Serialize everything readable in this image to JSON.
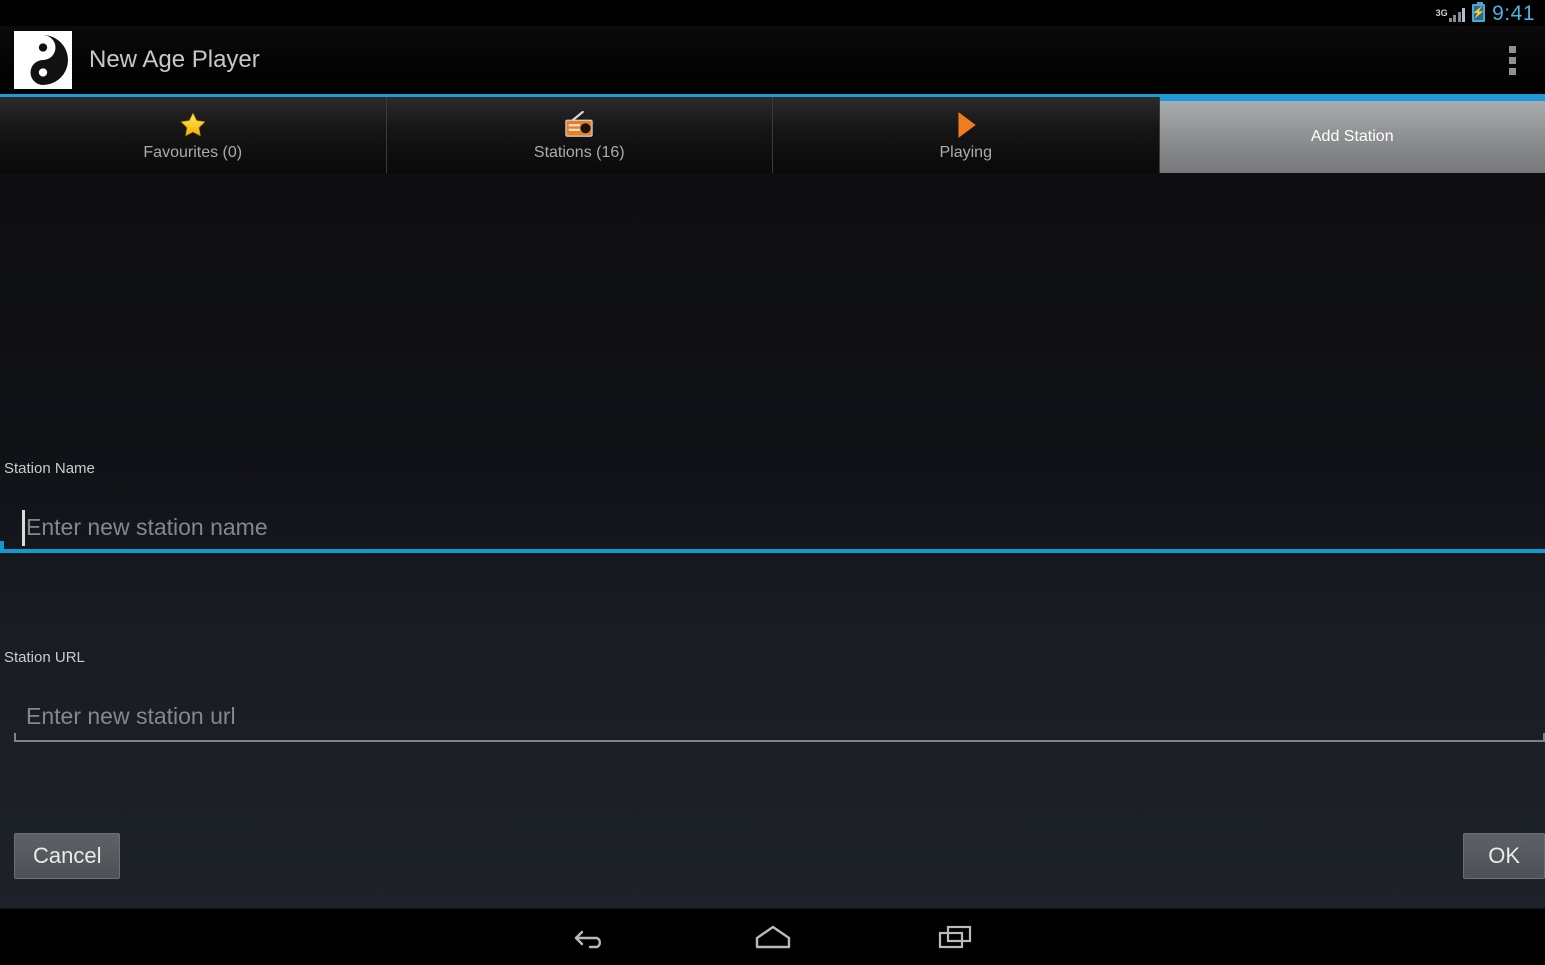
{
  "status_bar": {
    "network_label": "3G",
    "signal_icon": "signal-bars-icon",
    "battery_icon": "battery-charging-icon",
    "time": "9:41",
    "clock_color": "#4ab3e0"
  },
  "action_bar": {
    "app_icon": "yin-yang-icon",
    "title": "New Age Player",
    "overflow_icon": "overflow-menu-icon"
  },
  "tabs": [
    {
      "label": "Favourites (0)",
      "icon": "star-icon",
      "active": false
    },
    {
      "label": "Stations (16)",
      "icon": "radio-icon",
      "active": false
    },
    {
      "label": "Playing",
      "icon": "play-icon",
      "active": false
    },
    {
      "label": "Add Station",
      "icon": "",
      "active": true
    }
  ],
  "form": {
    "station_name": {
      "label": "Station Name",
      "value": "",
      "placeholder": "Enter new station name",
      "focused": true,
      "underline_color": "#0f9ad4"
    },
    "station_url": {
      "label": "Station URL",
      "value": "",
      "placeholder": "Enter new station url",
      "focused": false,
      "underline_color": "#7f8386"
    }
  },
  "buttons": {
    "cancel": "Cancel",
    "ok": "OK"
  },
  "nav_bar": {
    "back": "back-icon",
    "home": "home-icon",
    "recents": "recent-apps-icon"
  },
  "theme": {
    "accent": "#1b9ad6",
    "content_bg": "#14161b",
    "tab_bg": "#1a1a1a"
  }
}
